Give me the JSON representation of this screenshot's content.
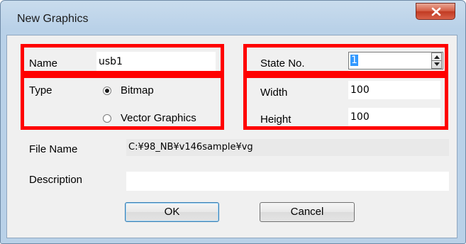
{
  "window": {
    "title": "New Graphics"
  },
  "form": {
    "name": {
      "label": "Name",
      "value": "usb1"
    },
    "type": {
      "label": "Type",
      "options": [
        {
          "label": "Bitmap",
          "selected": true
        },
        {
          "label": "Vector Graphics",
          "selected": false
        }
      ]
    },
    "state_no": {
      "label": "State No.",
      "value": "1"
    },
    "width": {
      "label": "Width",
      "value": "100"
    },
    "height": {
      "label": "Height",
      "value": "100"
    },
    "file_name": {
      "label": "File Name",
      "value": "C:¥98_NB¥v146sample¥vg"
    },
    "description": {
      "label": "Description",
      "value": ""
    }
  },
  "buttons": {
    "ok": "OK",
    "cancel": "Cancel"
  },
  "colors": {
    "highlight_border": "#ff0000",
    "selection": "#3399ff",
    "close_button": "#c9452e"
  },
  "icons": {
    "close": "close-icon",
    "spin_up": "spin-up-icon",
    "spin_down": "spin-down-icon"
  }
}
